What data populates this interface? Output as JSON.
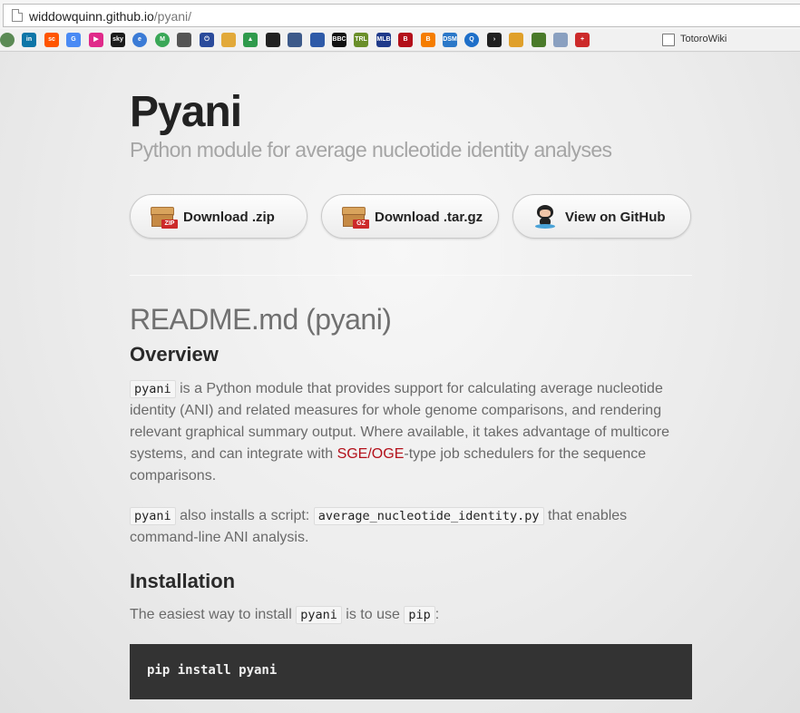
{
  "browser": {
    "url_host": "widdowquinn.github.io",
    "url_path": "/pyani/",
    "bookmarks": [
      {
        "icon": "puzzle-icon",
        "text": "",
        "color": "#5b8a55"
      },
      {
        "icon": "linkedin-icon",
        "text": "in",
        "color": "#0e76a8"
      },
      {
        "icon": "soundcloud-icon",
        "text": "sc",
        "color": "#ff5500"
      },
      {
        "icon": "google-translate-icon",
        "text": "G",
        "color": "#4a8af4"
      },
      {
        "icon": "play-icon",
        "text": "▶",
        "color": "#e02a8a"
      },
      {
        "icon": "sky-icon",
        "text": "sky",
        "color": "#1b1b1b"
      },
      {
        "icon": "browser-icon",
        "text": "e",
        "color": "#3b7bd6"
      },
      {
        "icon": "maps-icon",
        "text": "M",
        "color": "#3aa757"
      },
      {
        "icon": "apple-icon",
        "text": "",
        "color": "#555555"
      },
      {
        "icon": "power-icon",
        "text": "⏻",
        "color": "#2a4b9b"
      },
      {
        "icon": "box-icon",
        "text": "",
        "color": "#e2a93a"
      },
      {
        "icon": "drive-icon",
        "text": "▲",
        "color": "#2f9a4c"
      },
      {
        "icon": "github-icon",
        "text": "",
        "color": "#222222"
      },
      {
        "icon": "bucket-icon",
        "text": "",
        "color": "#3d5a8a"
      },
      {
        "icon": "people-icon",
        "text": "",
        "color": "#2e5aa8"
      },
      {
        "icon": "bbc-icon",
        "text": "BBC",
        "color": "#111111"
      },
      {
        "icon": "trl-icon",
        "text": "TRL",
        "color": "#6a8f2a"
      },
      {
        "icon": "mlb-icon",
        "text": "MLB",
        "color": "#1f3a8a"
      },
      {
        "icon": "red-sox-icon",
        "text": "B",
        "color": "#b3101a"
      },
      {
        "icon": "blogger-icon",
        "text": "B",
        "color": "#f57d00"
      },
      {
        "icon": "dsm-icon",
        "text": "DSM",
        "color": "#2b78c8"
      },
      {
        "icon": "q-icon",
        "text": "Q",
        "color": "#1e6fc9"
      },
      {
        "icon": "plex-icon",
        "text": "›",
        "color": "#202020"
      },
      {
        "icon": "weather-icon",
        "text": "",
        "color": "#e0a02a"
      },
      {
        "icon": "stripes-icon",
        "text": "",
        "color": "#4a7a2a"
      },
      {
        "icon": "bulb-icon",
        "text": "",
        "color": "#8aa0c0"
      },
      {
        "icon": "cross-icon",
        "text": "+",
        "color": "#cc2a2a"
      }
    ],
    "bookmark_folder_label": "TotoroWiki"
  },
  "header": {
    "title": "Pyani",
    "subtitle": "Python module for average nucleotide identity analyses"
  },
  "buttons": {
    "zip_label": "Download .zip",
    "zip_tag": "ZIP",
    "targz_label": "Download .tar.gz",
    "targz_tag": "GZ",
    "github_label": "View on GitHub"
  },
  "content": {
    "readme_title": "README.md (pyani)",
    "overview_heading": "Overview",
    "overview_code": "pyani",
    "overview_text_1": " is a Python module that provides support for calculating average nucleotide identity (ANI) and related measures for whole genome comparisons, and rendering relevant graphical summary output. Where available, it takes advantage of multicore systems, and can integrate with ",
    "overview_link": "SGE/OGE",
    "overview_text_2": "-type job schedulers for the sequence comparisons.",
    "script_code_1": "pyani",
    "script_text_1": " also installs a script: ",
    "script_code_2": "average_nucleotide_identity.py",
    "script_text_2": " that enables command-line ANI analysis.",
    "install_heading": "Installation",
    "install_text_1": "The easiest way to install ",
    "install_code_1": "pyani",
    "install_text_2": " is to use ",
    "install_code_2": "pip",
    "install_text_3": ":",
    "install_command": "pip install pyani"
  }
}
